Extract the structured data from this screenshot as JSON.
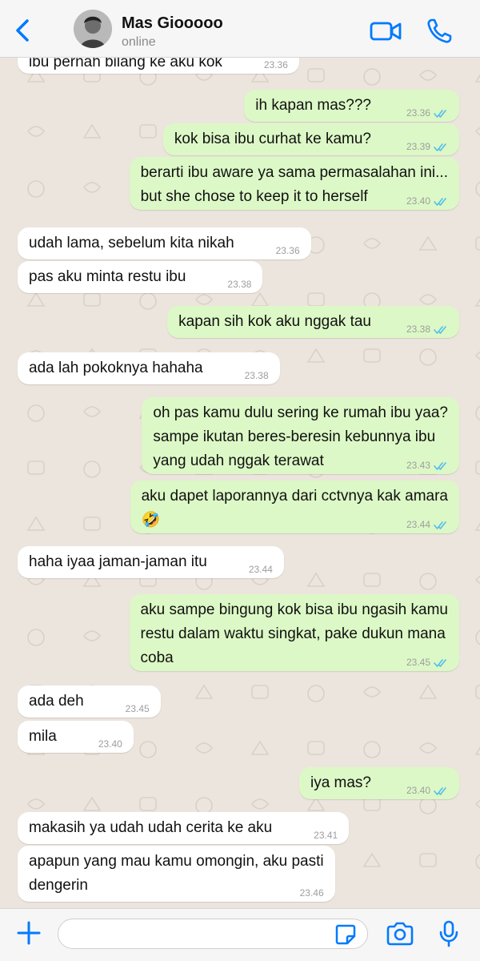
{
  "header": {
    "contact_name": "Mas Giooooo",
    "status": "online",
    "icons": [
      "back-chevron-icon",
      "avatar",
      "video-call-icon",
      "phone-icon"
    ]
  },
  "messages": [
    {
      "dir": "in",
      "lines": [
        "ibu pernah bilang ke aku kok"
      ],
      "time": "23.36"
    },
    {
      "dir": "out",
      "lines": [
        "ih kapan mas???"
      ],
      "time": "23.36",
      "read": true
    },
    {
      "dir": "out",
      "lines": [
        "kok bisa ibu curhat ke kamu?"
      ],
      "time": "23.39",
      "read": true
    },
    {
      "dir": "out",
      "lines": [
        "berarti ibu aware ya sama permasalahan ini...",
        "but she chose to keep it to herself"
      ],
      "time": "23.40",
      "read": true
    },
    {
      "dir": "in",
      "lines": [
        "udah lama, sebelum kita nikah"
      ],
      "time": "23.36"
    },
    {
      "dir": "in",
      "lines": [
        "pas aku minta restu ibu"
      ],
      "time": "23.38"
    },
    {
      "dir": "out",
      "lines": [
        "kapan sih kok aku nggak tau"
      ],
      "time": "23.38",
      "read": true
    },
    {
      "dir": "in",
      "lines": [
        "ada lah pokoknya hahaha"
      ],
      "time": "23.38"
    },
    {
      "dir": "out",
      "lines": [
        "oh pas kamu dulu sering ke rumah ibu yaa?",
        "sampe ikutan beres-beresin kebunnya ibu",
        "yang udah nggak terawat"
      ],
      "time": "23.43",
      "read": true
    },
    {
      "dir": "out",
      "lines": [
        "aku dapet laporannya dari cctvnya kak amara",
        "🤣"
      ],
      "time": "23.44",
      "read": true
    },
    {
      "dir": "in",
      "lines": [
        "haha iyaa jaman-jaman itu"
      ],
      "time": "23.44"
    },
    {
      "dir": "out",
      "lines": [
        "aku sampe bingung kok bisa ibu ngasih kamu",
        "restu dalam waktu singkat, pake dukun mana",
        "coba"
      ],
      "time": "23.45",
      "read": true
    },
    {
      "dir": "in",
      "lines": [
        "ada deh"
      ],
      "time": "23.45"
    },
    {
      "dir": "in",
      "lines": [
        "mila"
      ],
      "time": "23.40"
    },
    {
      "dir": "out",
      "lines": [
        "iya mas?"
      ],
      "time": "23.40",
      "read": true
    },
    {
      "dir": "in",
      "lines": [
        "makasih ya udah udah cerita ke aku"
      ],
      "time": "23.41"
    },
    {
      "dir": "in",
      "lines": [
        "apapun yang mau kamu omongin, aku pasti",
        "dengerin"
      ],
      "time": "23.46"
    }
  ],
  "composer": {
    "value": "",
    "icons": [
      "plus-icon",
      "sticker-icon",
      "camera-icon",
      "microphone-icon"
    ]
  },
  "colors": {
    "accent": "#007aff",
    "outgoing_bubble": "#dcf8c6",
    "incoming_bubble": "#ffffff",
    "read_ticks": "#53bdeb",
    "wallpaper": "#ece5dd"
  }
}
